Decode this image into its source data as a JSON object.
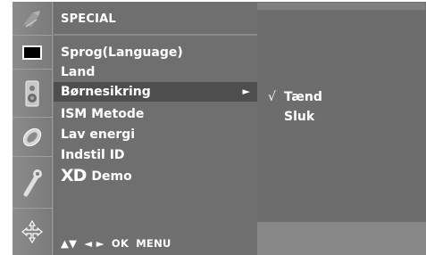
{
  "menu": {
    "title": "SPECIAL",
    "items": [
      {
        "label": "Sprog(Language)"
      },
      {
        "label": "Land"
      },
      {
        "label": "Børnesikring",
        "arrow": "►"
      },
      {
        "label": "ISM Metode"
      },
      {
        "label": "Lav energi"
      },
      {
        "label": "Indstil ID"
      },
      {
        "logo": "XD",
        "label": "Demo"
      }
    ],
    "selected_index": 2
  },
  "submenu": {
    "options": [
      {
        "check": "√",
        "label": "Tænd"
      },
      {
        "check": "",
        "label": "Sluk"
      }
    ]
  },
  "nav_hint": {
    "updown": "▲▼",
    "leftright": "◄ ►",
    "ok": "OK",
    "menu": "MENU"
  },
  "sidebar_icons": [
    "satellite-dish-icon",
    "screen-picture-icon",
    "speaker-sound-icon",
    "clock-time-icon",
    "wrench-special-icon",
    "screen-adjust-icon"
  ],
  "colors": {
    "osd_background": "#808080",
    "menu_panel": "#6f6f6f",
    "selected_row": "#4e4e4e",
    "text": "#ffffff"
  }
}
